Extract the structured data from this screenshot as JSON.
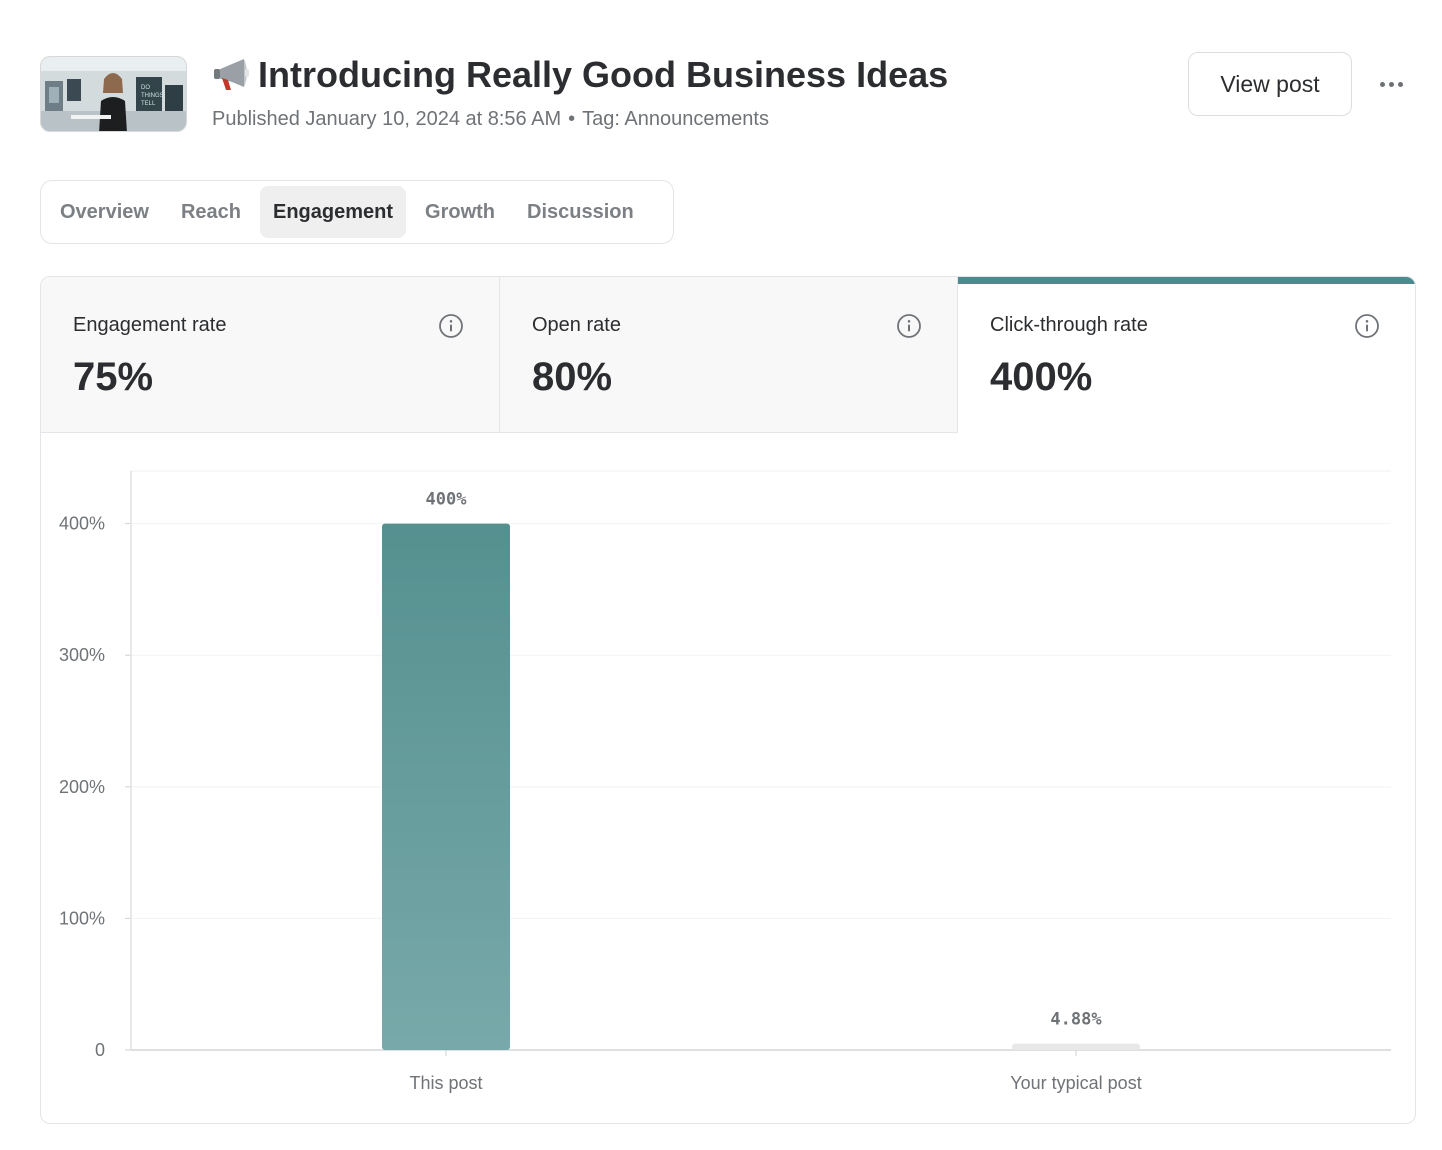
{
  "post": {
    "title": "Introducing Really Good Business Ideas",
    "published": "Published January 10, 2024 at 8:56 AM",
    "separator": "•",
    "tag": "Tag: Announcements",
    "title_icon": "megaphone-icon",
    "thumbnail_icon": "video-thumbnail"
  },
  "actions": {
    "view_post": "View post",
    "more_icon": "more-horizontal-icon"
  },
  "tabs": [
    {
      "label": "Overview",
      "active": false
    },
    {
      "label": "Reach",
      "active": false
    },
    {
      "label": "Engagement",
      "active": true
    },
    {
      "label": "Growth",
      "active": false
    },
    {
      "label": "Discussion",
      "active": false
    }
  ],
  "kpis": [
    {
      "label": "Engagement rate",
      "value": "75%",
      "active": false
    },
    {
      "label": "Open rate",
      "value": "80%",
      "active": false
    },
    {
      "label": "Click-through rate",
      "value": "400%",
      "active": true
    }
  ],
  "colors": {
    "accent": "#4b8b90",
    "bar_top": "#55908f",
    "bar_bottom": "#78a9aa",
    "bar_muted": "#e8e8e8"
  },
  "chart_data": {
    "type": "bar",
    "categories": [
      "This post",
      "Your typical post"
    ],
    "values": [
      400,
      4.88
    ],
    "value_labels": [
      "400%",
      "4.88%"
    ],
    "ylim": [
      0,
      440
    ],
    "yticks": [
      0,
      100,
      200,
      300,
      400
    ],
    "ytick_labels": [
      "0",
      "100%",
      "200%",
      "300%",
      "400%"
    ],
    "grid": true,
    "legend": "none"
  }
}
